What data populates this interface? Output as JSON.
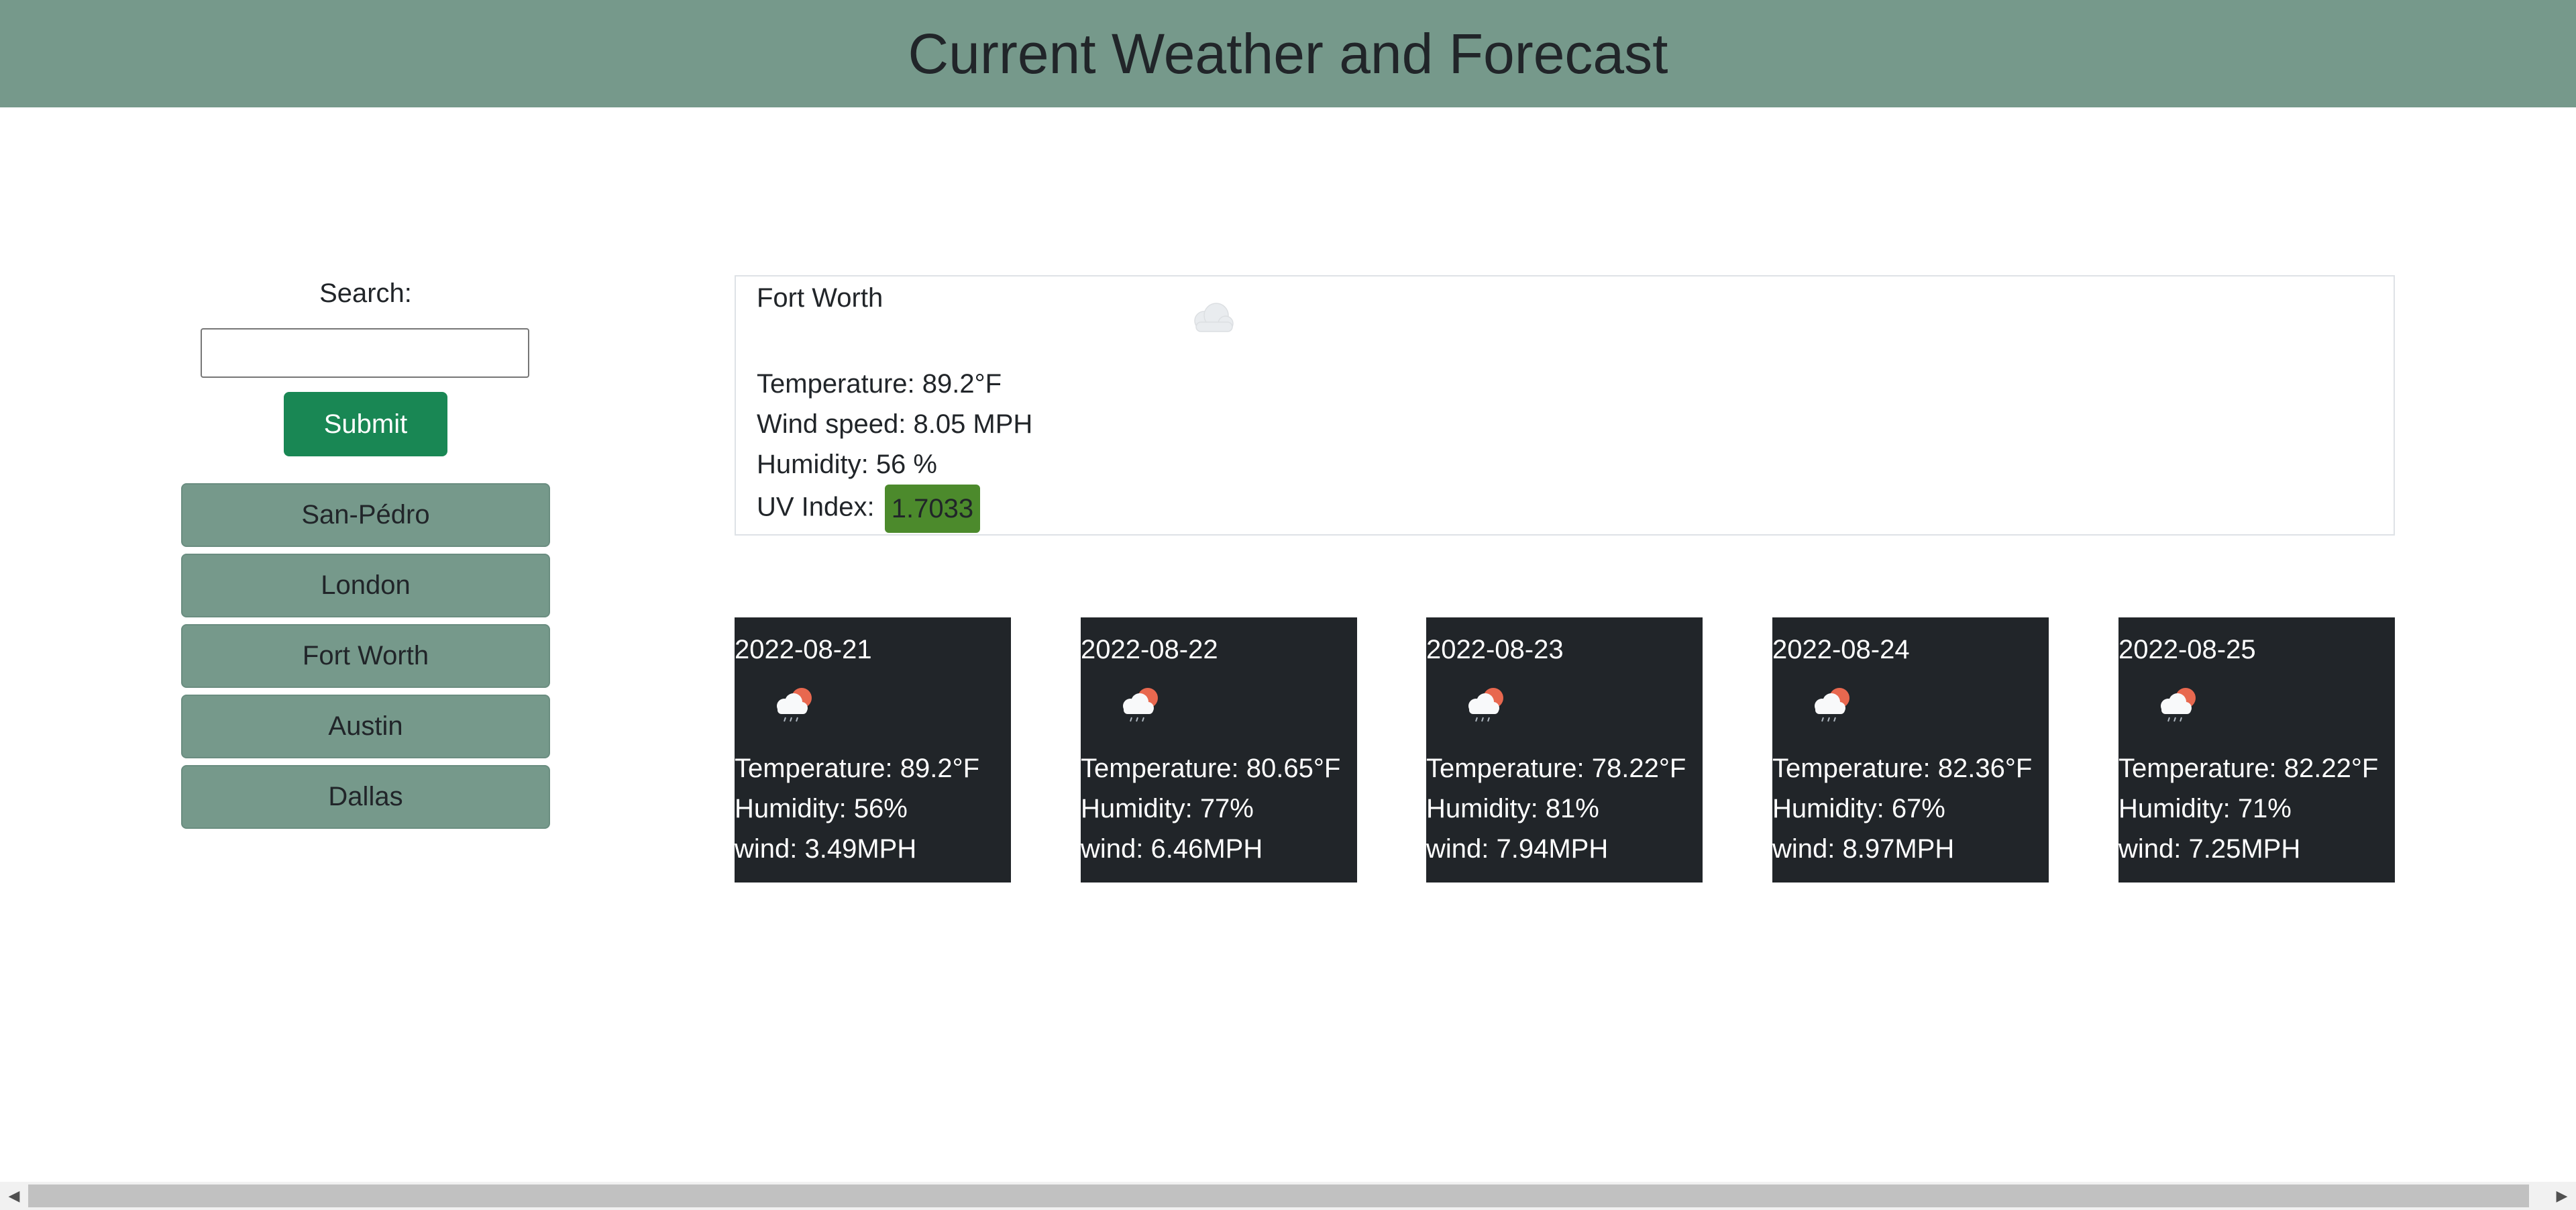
{
  "header": {
    "title": "Current Weather and Forecast"
  },
  "search": {
    "label": "Search:",
    "value": "",
    "placeholder": "",
    "submit_label": "Submit"
  },
  "history": [
    {
      "label": "San-Pédro"
    },
    {
      "label": "London"
    },
    {
      "label": "Fort Worth"
    },
    {
      "label": "Austin"
    },
    {
      "label": "Dallas"
    }
  ],
  "current": {
    "city": "Fort Worth",
    "icon": "cloud-icon",
    "temperature": "Temperature: 89.2°F",
    "wind": "Wind speed: 8.05 MPH",
    "humidity": "Humidity: 56 %",
    "uv_label": "UV Index:",
    "uv_value": "1.7033",
    "uv_color": "#4c8a2c"
  },
  "forecast": [
    {
      "date": "2022-08-21",
      "icon": "cloud-sun-rain-icon",
      "temperature": "Temperature: 89.2°F",
      "humidity": "Humidity: 56%",
      "wind": "wind: 3.49MPH"
    },
    {
      "date": "2022-08-22",
      "icon": "cloud-sun-rain-icon",
      "temperature": "Temperature: 80.65°F",
      "humidity": "Humidity: 77%",
      "wind": "wind: 6.46MPH"
    },
    {
      "date": "2022-08-23",
      "icon": "cloud-sun-rain-icon",
      "temperature": "Temperature: 78.22°F",
      "humidity": "Humidity: 81%",
      "wind": "wind: 7.94MPH"
    },
    {
      "date": "2022-08-24",
      "icon": "cloud-sun-rain-icon",
      "temperature": "Temperature: 82.36°F",
      "humidity": "Humidity: 67%",
      "wind": "wind: 8.97MPH"
    },
    {
      "date": "2022-08-25",
      "icon": "cloud-sun-rain-icon",
      "temperature": "Temperature: 82.22°F",
      "humidity": "Humidity: 71%",
      "wind": "wind: 7.25MPH"
    }
  ],
  "colors": {
    "header_bg": "#76998b",
    "submit_bg": "#198754",
    "forecast_bg": "#212529"
  }
}
